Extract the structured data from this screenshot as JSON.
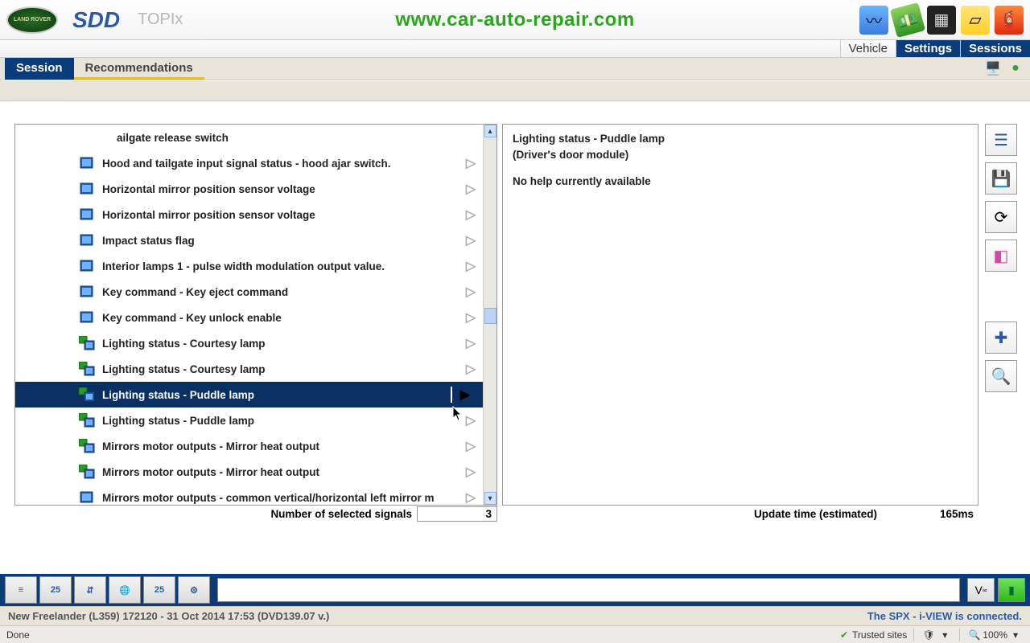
{
  "header": {
    "logo_text": "LAND ROVER",
    "app": "SDD",
    "topix": "TOPIx",
    "watermark": "www.car-auto-repair.com",
    "icons": [
      "monitor-icon",
      "money-icon",
      "calendar-icon",
      "note-icon",
      "extinguisher-icon"
    ]
  },
  "topnav": {
    "items": [
      "Vehicle",
      "Settings",
      "Sessions"
    ],
    "active_index": 1
  },
  "tabs": {
    "items": [
      "Session",
      "Recommendations"
    ],
    "active_index": 0
  },
  "signals": {
    "partial_first": "ailgate release switch",
    "items": [
      {
        "icon": "single",
        "label": "Hood and tailgate input signal status - hood ajar switch."
      },
      {
        "icon": "single",
        "label": "Horizontal mirror position sensor voltage"
      },
      {
        "icon": "single",
        "label": "Horizontal mirror position sensor voltage"
      },
      {
        "icon": "single",
        "label": "Impact status flag"
      },
      {
        "icon": "single",
        "label": "Interior lamps 1 - pulse width modulation output value."
      },
      {
        "icon": "single",
        "label": "Key command  -  Key eject command"
      },
      {
        "icon": "single",
        "label": "Key command  -  Key unlock enable"
      },
      {
        "icon": "multi",
        "label": "Lighting status  -  Courtesy lamp"
      },
      {
        "icon": "multi",
        "label": "Lighting status  -  Courtesy lamp"
      },
      {
        "icon": "multi",
        "label": "Lighting status  -  Puddle lamp",
        "selected": true
      },
      {
        "icon": "multi",
        "label": "Lighting status  -  Puddle lamp"
      },
      {
        "icon": "multi",
        "label": "Mirrors motor outputs  -  Mirror heat output"
      },
      {
        "icon": "multi",
        "label": "Mirrors motor outputs  -  Mirror heat output"
      },
      {
        "icon": "single",
        "label": "Mirrors motor outputs - common vertical/horizontal left mirror m"
      }
    ]
  },
  "detail": {
    "title": "Lighting status  -  Puddle lamp",
    "module": "(Driver's door module)",
    "help": "No help currently available"
  },
  "stats": {
    "selected_label": "Number of selected signals",
    "selected_value": "3",
    "update_label": "Update time (estimated)",
    "update_value": "165ms"
  },
  "footer": {
    "vehicle": "New Freelander (L359) 172120 - 31 Oct 2014 17:53 (DVD139.07 v.)",
    "connection": "The SPX - i-VIEW is connected.",
    "status": "Done",
    "trusted": "Trusted sites",
    "zoom": "100%"
  }
}
